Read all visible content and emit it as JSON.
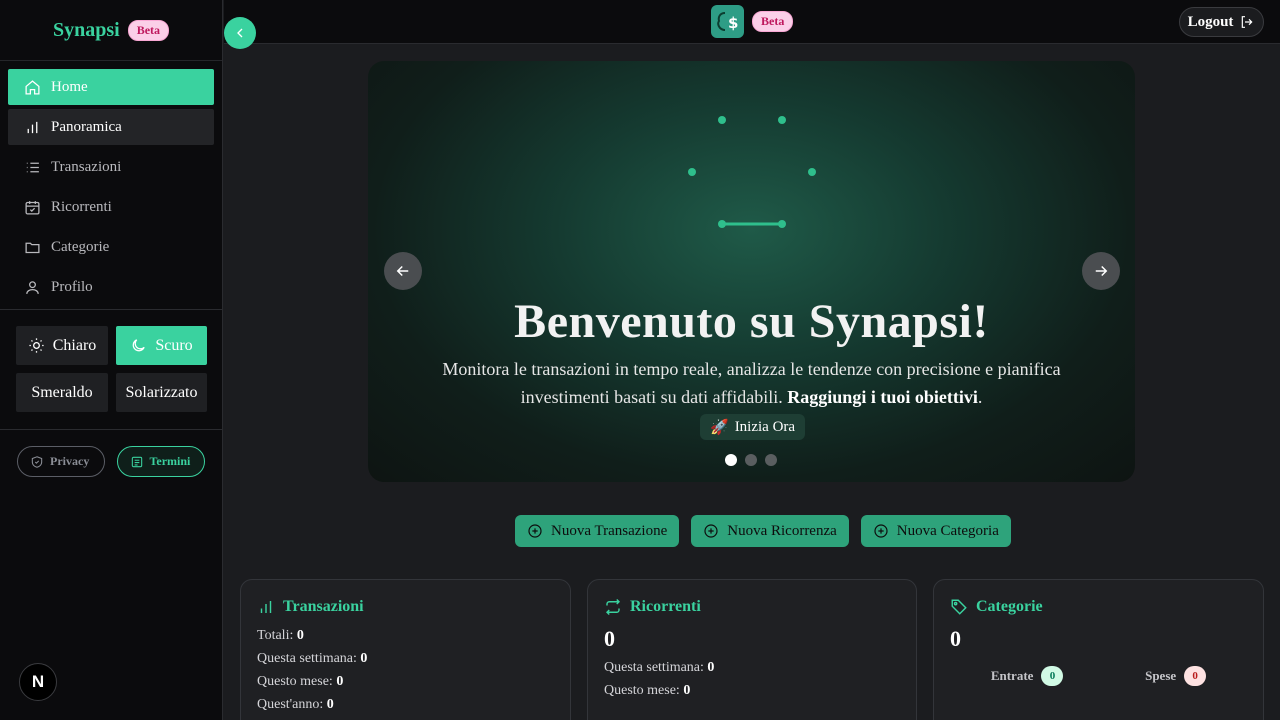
{
  "brand": {
    "name": "Synapsi",
    "badge": "Beta"
  },
  "sidebar": {
    "items": [
      {
        "label": "Home",
        "icon": "home-icon"
      },
      {
        "label": "Panoramica",
        "icon": "bar-chart-icon"
      },
      {
        "label": "Transazioni",
        "icon": "list-icon"
      },
      {
        "label": "Ricorrenti",
        "icon": "calendar-check-icon"
      },
      {
        "label": "Categorie",
        "icon": "folder-icon"
      },
      {
        "label": "Profilo",
        "icon": "user-icon"
      }
    ],
    "themes": [
      "Chiaro",
      "Scuro",
      "Smeraldo",
      "Solarizzato"
    ],
    "legal": {
      "privacy": "Privacy",
      "terms": "Termini"
    },
    "next_badge": "N"
  },
  "topbar": {
    "badge": "Beta",
    "logout": "Logout"
  },
  "hero": {
    "title": "Benvenuto su Synapsi!",
    "subtitle": "Monitora le transazioni in tempo reale, analizza le tendenze con precisione e pianifica investimenti basati su dati affidabili.",
    "subtitle_bold": "Raggiungi i tuoi obiettivi",
    "subtitle_end": ".",
    "cta": "Inizia Ora",
    "cta_emoji": "🚀",
    "slides": 3,
    "active_slide": 1
  },
  "actions": [
    "Nuova Transazione",
    "Nuova Ricorrenza",
    "Nuova Categoria"
  ],
  "cards": {
    "transactions": {
      "title": "Transazioni",
      "rows": [
        {
          "label": "Totali:",
          "value": "0"
        },
        {
          "label": "Questa settimana:",
          "value": "0"
        },
        {
          "label": "Questo mese:",
          "value": "0"
        },
        {
          "label": "Quest'anno:",
          "value": "0"
        }
      ]
    },
    "recurring": {
      "title": "Ricorrenti",
      "total": "0",
      "rows": [
        {
          "label": "Questa settimana:",
          "value": "0"
        },
        {
          "label": "Questo mese:",
          "value": "0"
        }
      ]
    },
    "categories": {
      "title": "Categorie",
      "total": "0",
      "income_label": "Entrate",
      "income_value": "0",
      "expense_label": "Spese",
      "expense_value": "0"
    }
  },
  "colors": {
    "accent": "#3ad29f",
    "background": "#1b1c1f",
    "sidebar": "#0b0b0d"
  }
}
